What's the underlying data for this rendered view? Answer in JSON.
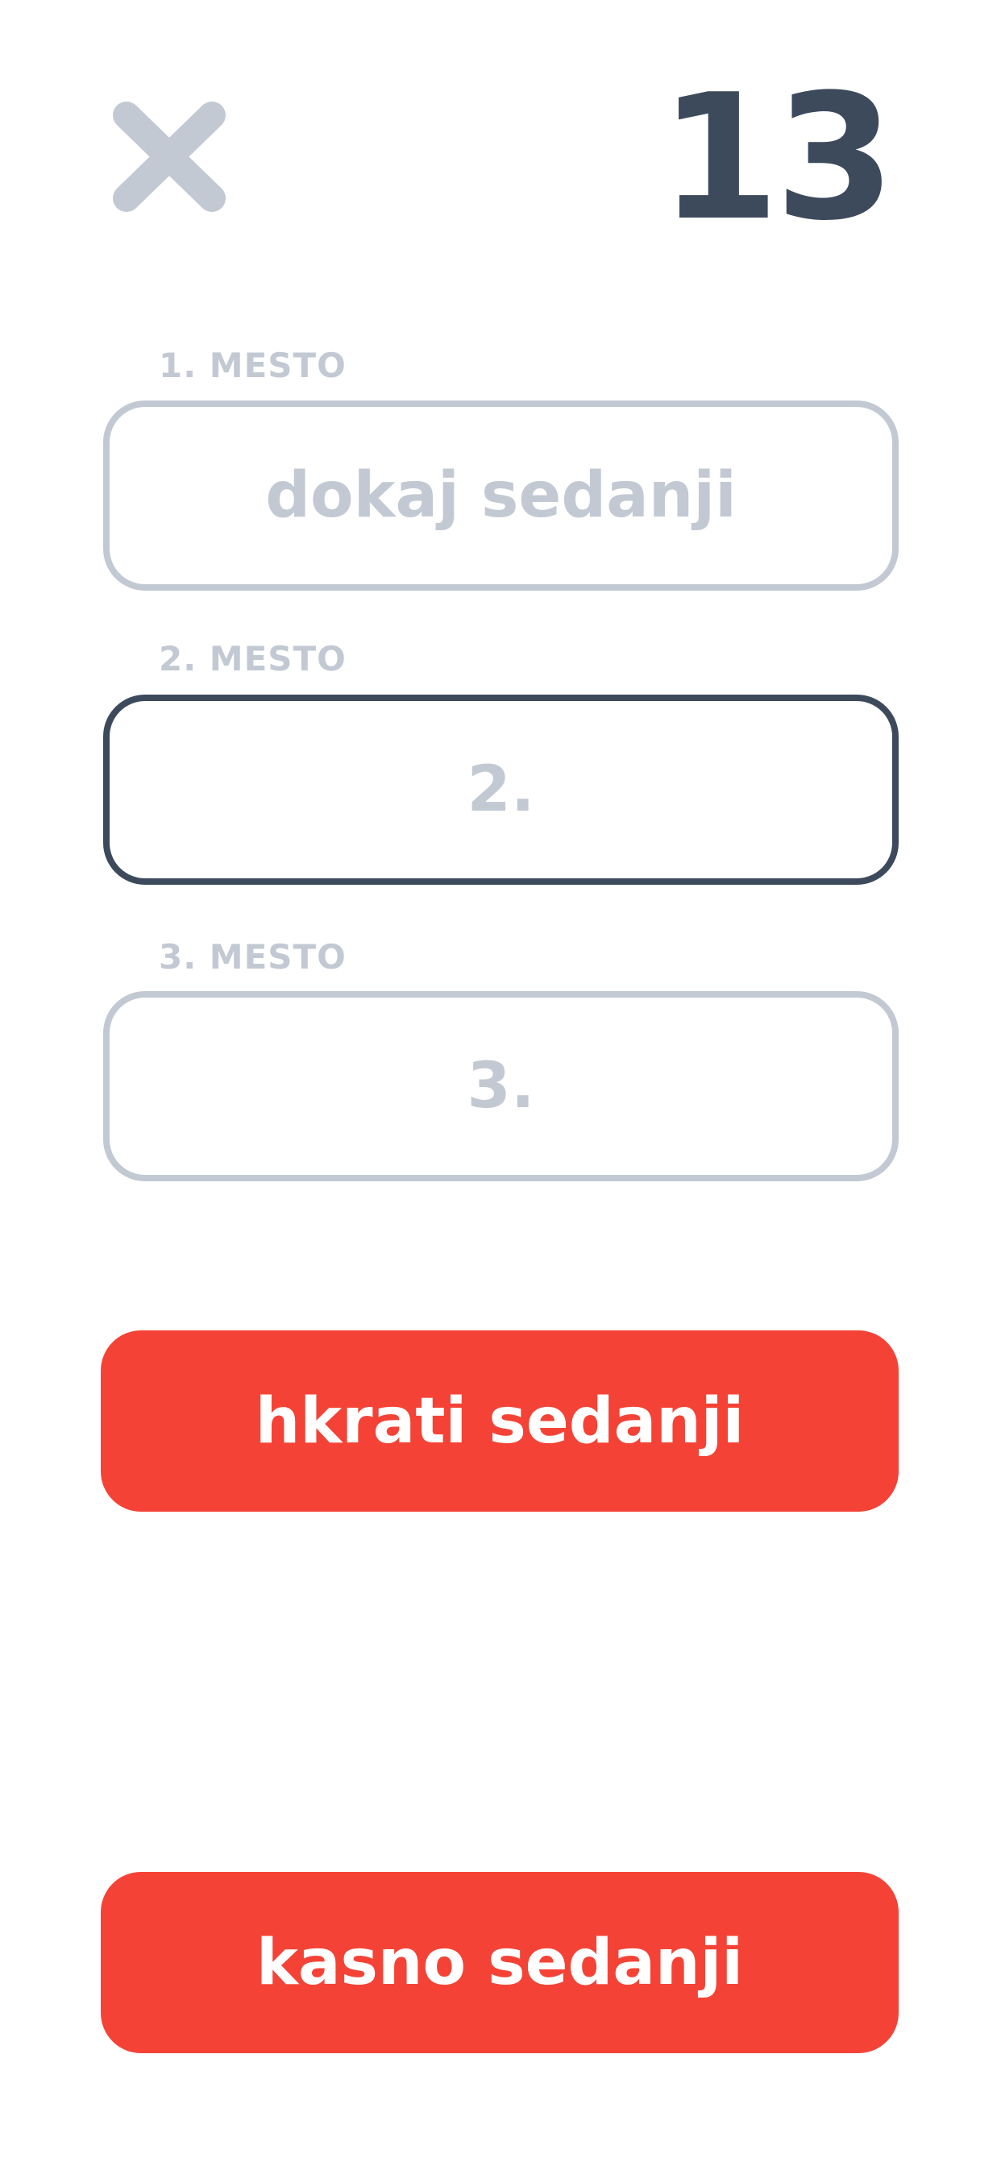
{
  "header": {
    "close_icon": "close-icon",
    "counter": "13"
  },
  "slots": [
    {
      "label": "1. MESTO",
      "value": "dokaj sedanji",
      "active": false
    },
    {
      "label": "2. MESTO",
      "value": "2.",
      "active": true
    },
    {
      "label": "3. MESTO",
      "value": "3.",
      "active": false
    }
  ],
  "buttons": [
    {
      "label": "hkrati sedanji"
    },
    {
      "label": "kasno sedanji"
    }
  ],
  "colors": {
    "muted": "#C3C9D3",
    "dark": "#3D4A5C",
    "accent": "#F44336"
  }
}
